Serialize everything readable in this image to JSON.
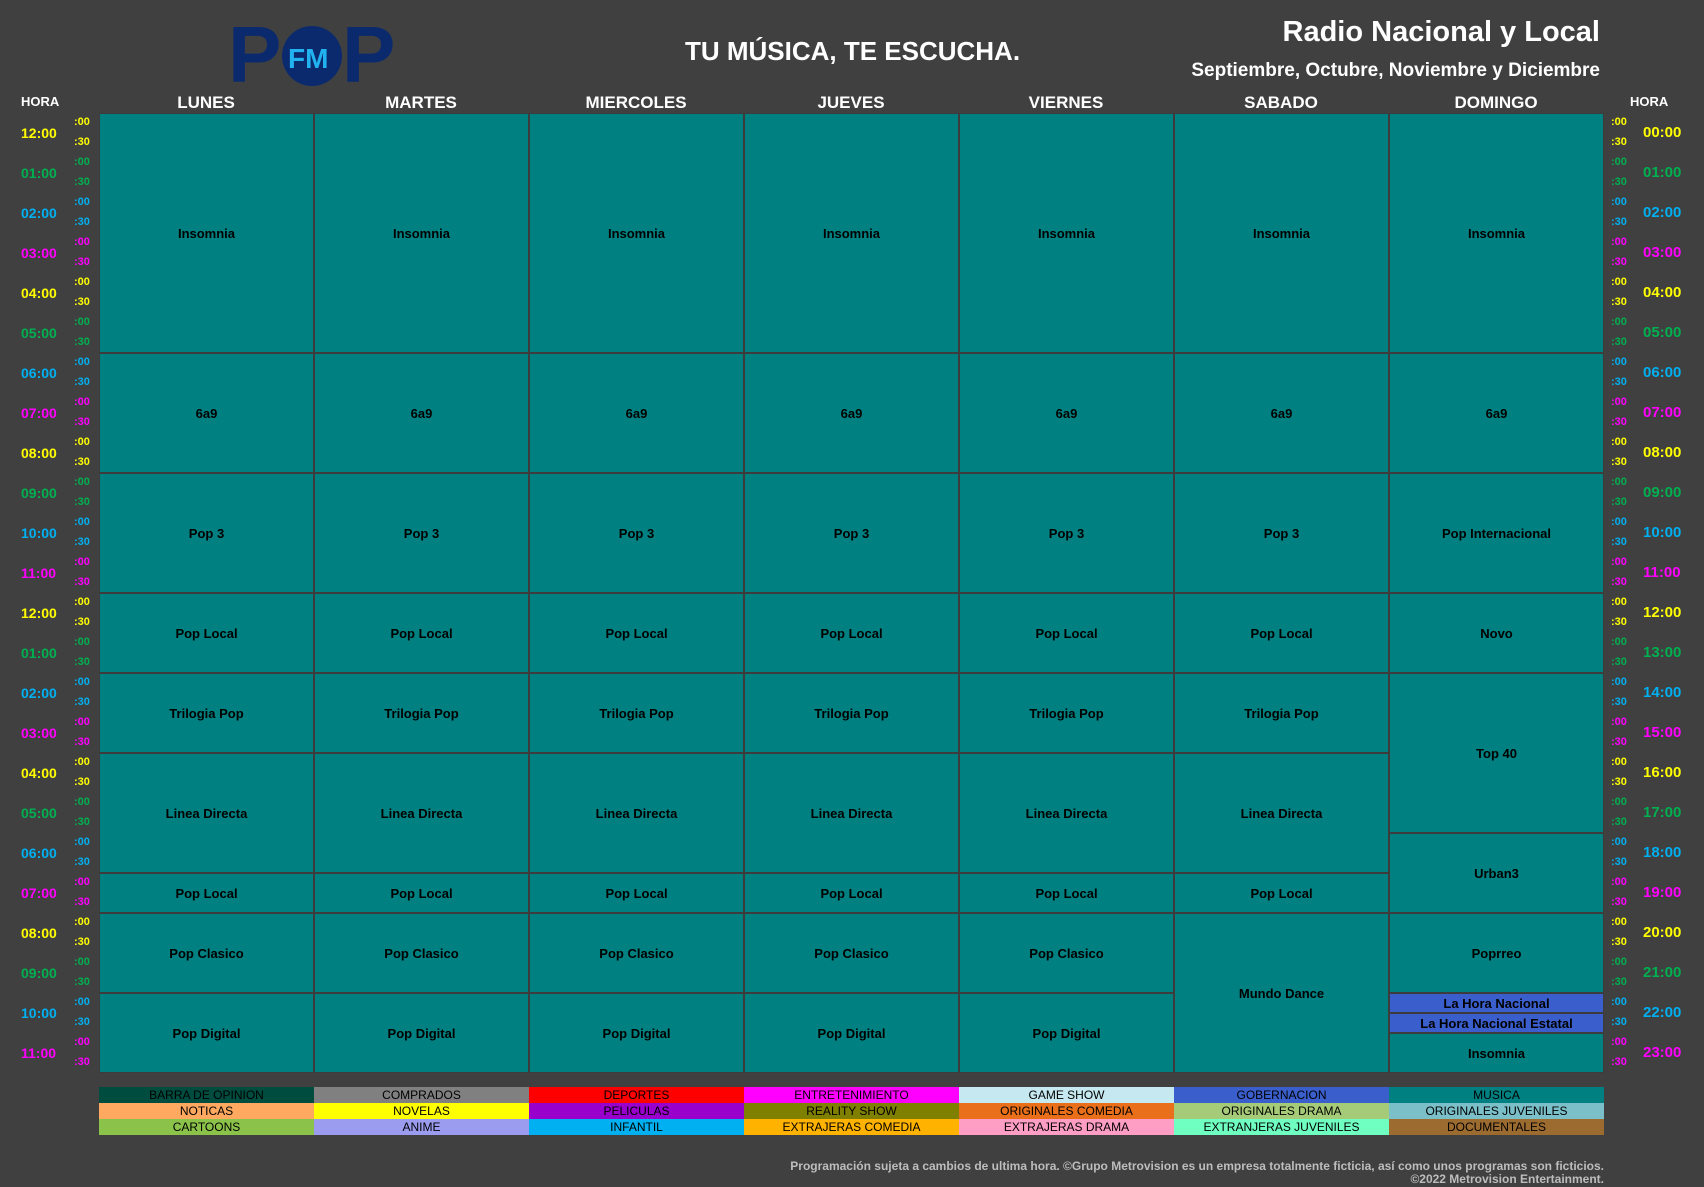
{
  "header": {
    "logo_text": "POP FM",
    "slogan": "TU MÚSICA, TE ESCUCHA.",
    "brand": "Radio Nacional y Local",
    "season": "Septiembre, Octubre, Noviembre y Diciembre"
  },
  "hora_label": "HORA",
  "days": [
    "LUNES",
    "MARTES",
    "MIERCOLES",
    "JUEVES",
    "VIERNES",
    "SABADO",
    "DOMINGO"
  ],
  "hours_left": [
    "12:00",
    "01:00",
    "02:00",
    "03:00",
    "04:00",
    "05:00",
    "06:00",
    "07:00",
    "08:00",
    "09:00",
    "10:00",
    "11:00",
    "12:00",
    "01:00",
    "02:00",
    "03:00",
    "04:00",
    "05:00",
    "06:00",
    "07:00",
    "08:00",
    "09:00",
    "10:00",
    "11:00"
  ],
  "hours_right": [
    "00:00",
    "01:00",
    "02:00",
    "03:00",
    "04:00",
    "05:00",
    "06:00",
    "07:00",
    "08:00",
    "09:00",
    "10:00",
    "11:00",
    "12:00",
    "13:00",
    "14:00",
    "15:00",
    "16:00",
    "17:00",
    "18:00",
    "19:00",
    "20:00",
    "21:00",
    "22:00",
    "23:00"
  ],
  "minute_labels": [
    ":00",
    ":30"
  ],
  "hour_colors": [
    "#ffff00",
    "#00b050",
    "#00b0f0",
    "#ff00ff"
  ],
  "colors": {
    "background": "#404040",
    "program": "#008080",
    "news_blue": "#3a5fcd"
  },
  "schedule": [
    {
      "day": 0,
      "blocks": [
        {
          "start": 0,
          "end": 12,
          "title": "Insomnia"
        },
        {
          "start": 12,
          "end": 18,
          "title": "6a9"
        },
        {
          "start": 18,
          "end": 24,
          "title": "Pop 3"
        },
        {
          "start": 24,
          "end": 28,
          "title": "Pop Local"
        },
        {
          "start": 28,
          "end": 32,
          "title": "Trilogia Pop"
        },
        {
          "start": 32,
          "end": 38,
          "title": "Linea Directa"
        },
        {
          "start": 38,
          "end": 40,
          "title": "Pop Local"
        },
        {
          "start": 40,
          "end": 44,
          "title": "Pop Clasico"
        },
        {
          "start": 44,
          "end": 48,
          "title": "Pop Digital"
        }
      ]
    },
    {
      "day": 1,
      "blocks": [
        {
          "start": 0,
          "end": 12,
          "title": "Insomnia"
        },
        {
          "start": 12,
          "end": 18,
          "title": "6a9"
        },
        {
          "start": 18,
          "end": 24,
          "title": "Pop 3"
        },
        {
          "start": 24,
          "end": 28,
          "title": "Pop Local"
        },
        {
          "start": 28,
          "end": 32,
          "title": "Trilogia Pop"
        },
        {
          "start": 32,
          "end": 38,
          "title": "Linea Directa"
        },
        {
          "start": 38,
          "end": 40,
          "title": "Pop Local"
        },
        {
          "start": 40,
          "end": 44,
          "title": "Pop Clasico"
        },
        {
          "start": 44,
          "end": 48,
          "title": "Pop Digital"
        }
      ]
    },
    {
      "day": 2,
      "blocks": [
        {
          "start": 0,
          "end": 12,
          "title": "Insomnia"
        },
        {
          "start": 12,
          "end": 18,
          "title": "6a9"
        },
        {
          "start": 18,
          "end": 24,
          "title": "Pop 3"
        },
        {
          "start": 24,
          "end": 28,
          "title": "Pop Local"
        },
        {
          "start": 28,
          "end": 32,
          "title": "Trilogia Pop"
        },
        {
          "start": 32,
          "end": 38,
          "title": "Linea Directa"
        },
        {
          "start": 38,
          "end": 40,
          "title": "Pop Local"
        },
        {
          "start": 40,
          "end": 44,
          "title": "Pop Clasico"
        },
        {
          "start": 44,
          "end": 48,
          "title": "Pop Digital"
        }
      ]
    },
    {
      "day": 3,
      "blocks": [
        {
          "start": 0,
          "end": 12,
          "title": "Insomnia"
        },
        {
          "start": 12,
          "end": 18,
          "title": "6a9"
        },
        {
          "start": 18,
          "end": 24,
          "title": "Pop 3"
        },
        {
          "start": 24,
          "end": 28,
          "title": "Pop Local"
        },
        {
          "start": 28,
          "end": 32,
          "title": "Trilogia Pop"
        },
        {
          "start": 32,
          "end": 38,
          "title": "Linea Directa"
        },
        {
          "start": 38,
          "end": 40,
          "title": "Pop Local"
        },
        {
          "start": 40,
          "end": 44,
          "title": "Pop Clasico"
        },
        {
          "start": 44,
          "end": 48,
          "title": "Pop Digital"
        }
      ]
    },
    {
      "day": 4,
      "blocks": [
        {
          "start": 0,
          "end": 12,
          "title": "Insomnia"
        },
        {
          "start": 12,
          "end": 18,
          "title": "6a9"
        },
        {
          "start": 18,
          "end": 24,
          "title": "Pop 3"
        },
        {
          "start": 24,
          "end": 28,
          "title": "Pop Local"
        },
        {
          "start": 28,
          "end": 32,
          "title": "Trilogia Pop"
        },
        {
          "start": 32,
          "end": 38,
          "title": "Linea Directa"
        },
        {
          "start": 38,
          "end": 40,
          "title": "Pop Local"
        },
        {
          "start": 40,
          "end": 44,
          "title": "Pop Clasico"
        },
        {
          "start": 44,
          "end": 48,
          "title": "Pop Digital"
        }
      ]
    },
    {
      "day": 5,
      "blocks": [
        {
          "start": 0,
          "end": 12,
          "title": "Insomnia"
        },
        {
          "start": 12,
          "end": 18,
          "title": "6a9"
        },
        {
          "start": 18,
          "end": 24,
          "title": "Pop 3"
        },
        {
          "start": 24,
          "end": 28,
          "title": "Pop Local"
        },
        {
          "start": 28,
          "end": 32,
          "title": "Trilogia Pop"
        },
        {
          "start": 32,
          "end": 38,
          "title": "Linea Directa"
        },
        {
          "start": 38,
          "end": 40,
          "title": "Pop Local"
        },
        {
          "start": 40,
          "end": 48,
          "title": "Mundo Dance"
        }
      ]
    },
    {
      "day": 6,
      "blocks": [
        {
          "start": 0,
          "end": 12,
          "title": "Insomnia"
        },
        {
          "start": 12,
          "end": 18,
          "title": "6a9"
        },
        {
          "start": 18,
          "end": 24,
          "title": "Pop Internacional"
        },
        {
          "start": 24,
          "end": 28,
          "title": "Novo"
        },
        {
          "start": 28,
          "end": 36,
          "title": "Top 40"
        },
        {
          "start": 36,
          "end": 40,
          "title": "Urban3"
        },
        {
          "start": 40,
          "end": 44,
          "title": "Poprreo"
        },
        {
          "start": 44,
          "end": 45,
          "title": "La Hora Nacional",
          "color": "news_blue"
        },
        {
          "start": 45,
          "end": 46,
          "title": "La Hora Nacional Estatal",
          "color": "news_blue"
        },
        {
          "start": 46,
          "end": 48,
          "title": "Insomnia"
        }
      ]
    }
  ],
  "legend": [
    {
      "label": "BARRA DE OPINION",
      "color": "#004d40"
    },
    {
      "label": "COMPRADOS",
      "color": "#808080"
    },
    {
      "label": "DEPORTES",
      "color": "#ff0000"
    },
    {
      "label": "ENTRETENIMIENTO",
      "color": "#ff00ff"
    },
    {
      "label": "GAME SHOW",
      "color": "#c6e8f0"
    },
    {
      "label": "GOBERNACION",
      "color": "#3a5fcd"
    },
    {
      "label": "MUSICA",
      "color": "#008080"
    },
    {
      "label": "NOTICAS",
      "color": "#ffa860"
    },
    {
      "label": "NOVELAS",
      "color": "#ffff00"
    },
    {
      "label": "PELICULAS",
      "color": "#9900cc"
    },
    {
      "label": "REALITY SHOW",
      "color": "#808000"
    },
    {
      "label": "ORIGINALES COMEDIA",
      "color": "#ea6f1a"
    },
    {
      "label": "ORIGINALES DRAMA",
      "color": "#a6cb78"
    },
    {
      "label": "ORIGINALES JUVENILES",
      "color": "#7bbfc9"
    },
    {
      "label": "CARTOONS",
      "color": "#8bc34a"
    },
    {
      "label": "ANIME",
      "color": "#9b9bf0"
    },
    {
      "label": "INFANTIL",
      "color": "#00b0f0"
    },
    {
      "label": "EXTRAJERAS COMEDIA",
      "color": "#ffb300"
    },
    {
      "label": "EXTRAJERAS DRAMA",
      "color": "#ff9ec5"
    },
    {
      "label": "EXTRANJERAS JUVENILES",
      "color": "#6fffc0"
    },
    {
      "label": "DOCUMENTALES",
      "color": "#9c6b30"
    }
  ],
  "footer": {
    "line1": "Programación sujeta a cambios de ultima hora. ©Grupo Metrovision es un empresa totalmente ficticia, así como unos programas son ficticios.",
    "line2": "©2022 Metrovision Entertainment."
  }
}
